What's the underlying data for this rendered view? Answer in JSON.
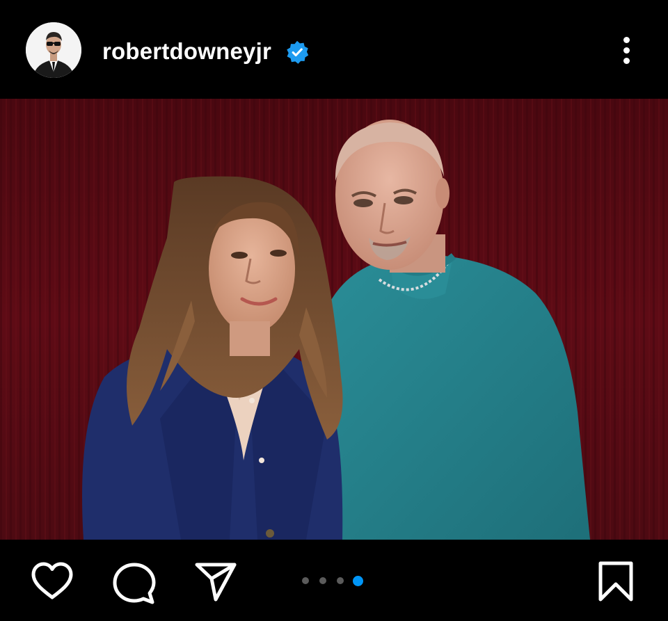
{
  "post": {
    "username": "robertdowneyjr",
    "verified": true,
    "carousel": {
      "total": 4,
      "active_index": 4
    }
  },
  "icons": {
    "avatar": "profile-photo",
    "verified": "verified-badge-icon",
    "more": "more-options-icon",
    "like": "heart-icon",
    "comment": "comment-bubble-icon",
    "share": "paper-plane-icon",
    "save": "bookmark-icon"
  },
  "colors": {
    "background": "#000000",
    "verified_blue": "#1d9bf0",
    "carousel_active": "#0095f6",
    "carousel_inactive": "#5b5b5b",
    "photo_backdrop": "#5a0a12"
  }
}
